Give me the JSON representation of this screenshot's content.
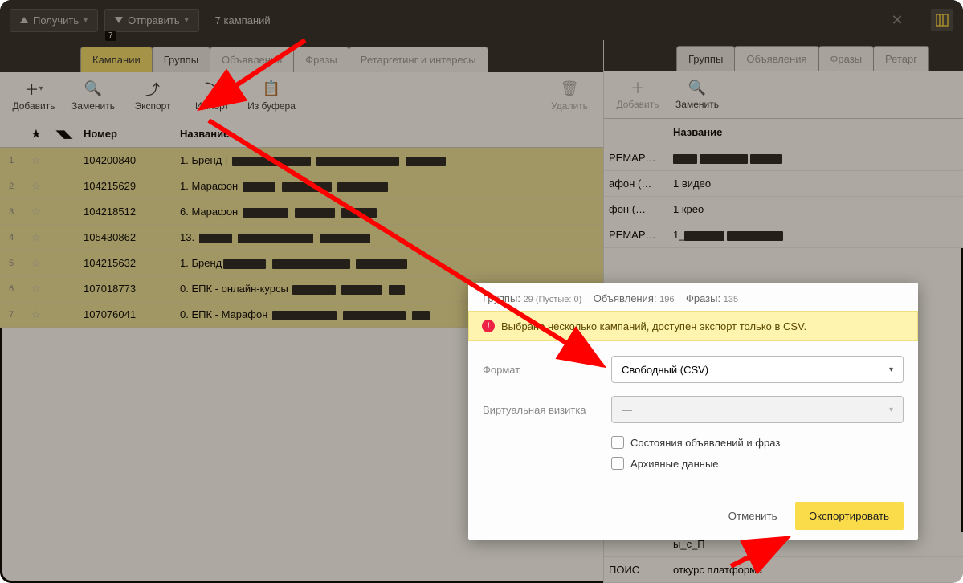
{
  "topbar": {
    "get": "Получить",
    "send": "Отправить",
    "count": "7 кампаний",
    "badge": "7"
  },
  "tabs_left": [
    {
      "label": "Кампании",
      "active": true
    },
    {
      "label": "Группы",
      "active": false
    },
    {
      "label": "Объявления",
      "gray": true
    },
    {
      "label": "Фразы",
      "gray": true
    },
    {
      "label": "Ретаргетинг и интересы",
      "gray": true
    }
  ],
  "tabs_right": [
    {
      "label": "Группы",
      "active": false
    },
    {
      "label": "Объявления",
      "gray": true
    },
    {
      "label": "Фразы",
      "gray": true
    },
    {
      "label": "Ретарг",
      "gray": true
    }
  ],
  "tools_left": [
    {
      "icon": "＋",
      "label": "Добавить",
      "dis": false,
      "chev": true
    },
    {
      "icon": "🔍",
      "label": "Заменить",
      "dis": false
    },
    {
      "icon": "⤴",
      "label": "Экспорт",
      "dis": false
    },
    {
      "icon": "⤵",
      "label": "Импорт",
      "dis": false
    },
    {
      "icon": "📋",
      "label": "Из буфера",
      "dis": false
    },
    {
      "spacer": true
    },
    {
      "icon": "🗑",
      "label": "Удалить",
      "dis": true
    }
  ],
  "tools_right": [
    {
      "icon": "＋",
      "label": "Добавить",
      "dis": true
    },
    {
      "icon": "🔍",
      "label": "Заменить",
      "dis": false
    }
  ],
  "head_left": {
    "star": "★",
    "send": "◥◣",
    "num": "Номер",
    "name": "Название"
  },
  "head_right": {
    "name": "Название"
  },
  "rows_left": [
    {
      "idx": "1",
      "num": "104200840",
      "name": "1. Бренд | "
    },
    {
      "idx": "2",
      "num": "104215629",
      "name": "1. Марафон "
    },
    {
      "idx": "3",
      "num": "104218512",
      "name": "6. Марафон "
    },
    {
      "idx": "4",
      "num": "105430862",
      "name": "13. "
    },
    {
      "idx": "5",
      "num": "104215632",
      "name": "1. Бренд"
    },
    {
      "idx": "6",
      "num": "107018773",
      "name": "0. ЕПК - онлайн-курсы "
    },
    {
      "idx": "7",
      "num": "107076041",
      "name": "0. ЕПК - Марафон "
    }
  ],
  "rows_right": [
    {
      "c1": "РЕМАР…",
      "c2": ""
    },
    {
      "c1": "афон (…",
      "c2": "1 видео"
    },
    {
      "c1": "фон (…",
      "c2": "1 крео"
    },
    {
      "c1": "РЕМАР…",
      "c2": "1_"
    }
  ],
  "rows_right_tail": [
    {
      "c1": "",
      "c2": "ы_с_П"
    },
    {
      "c1": "ПОИС",
      "c2": "откурс платформа"
    }
  ],
  "popup": {
    "stats": {
      "g": "Группы:",
      "gv": "29 (Пустые: 0)",
      "a": "Объявления:",
      "av": "196",
      "f": "Фразы:",
      "fv": "135"
    },
    "warn": "Выбрано несколько кампаний, доступен экспорт только в CSV.",
    "format_l": "Формат",
    "format_v": "Свободный (CSV)",
    "vcard_l": "Виртуальная визитка",
    "vcard_v": "—",
    "chk1": "Состояния объявлений и фраз",
    "chk2": "Архивные данные",
    "cancel": "Отменить",
    "export": "Экспортировать"
  }
}
